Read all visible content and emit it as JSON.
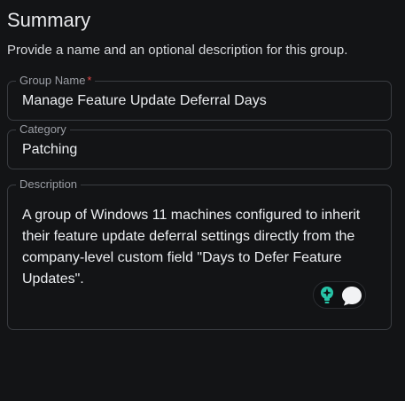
{
  "summary": {
    "title": "Summary",
    "subtitle": "Provide a name and an optional description for this group."
  },
  "fields": {
    "group_name": {
      "label": "Group Name",
      "required_marker": "*",
      "value": "Manage Feature Update Deferral Days"
    },
    "category": {
      "label": "Category",
      "value": "Patching"
    },
    "description": {
      "label": "Description",
      "value": "A group of Windows 11 machines configured to inherit their feature update deferral settings directly from the company-level custom field \"Days to Defer Feature Updates\"."
    }
  },
  "assistant": {
    "icons": [
      "lightbulb-sparkle-icon",
      "chat-bubble-icon"
    ]
  },
  "colors": {
    "background": "#131416",
    "border": "#3a3d42",
    "label": "#9b9ea5",
    "required": "#e04848",
    "accent_teal": "#27c5a8"
  }
}
